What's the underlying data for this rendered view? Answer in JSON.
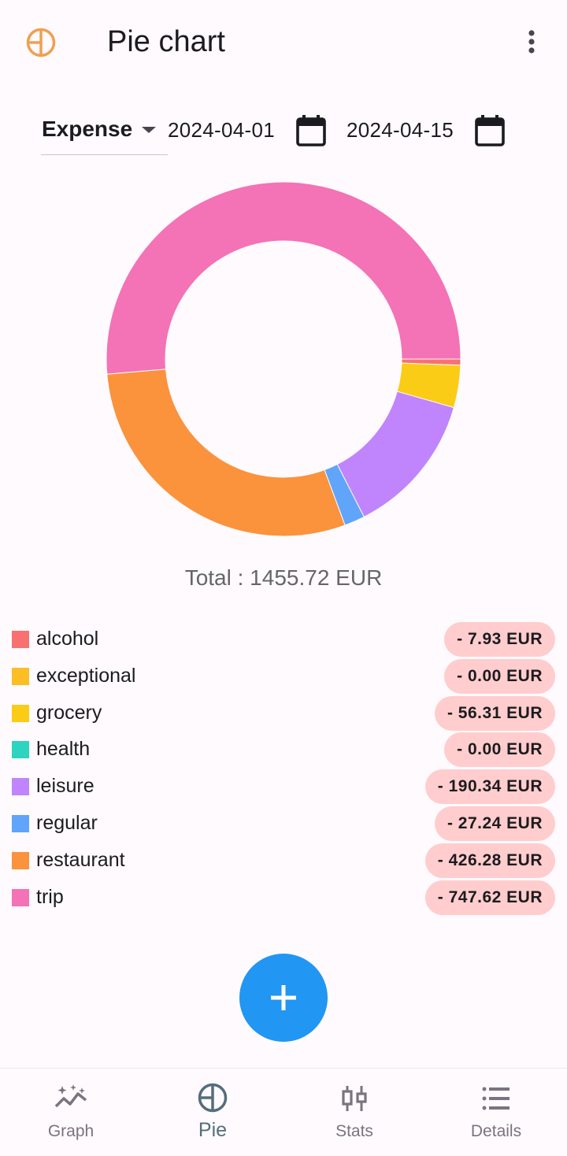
{
  "app_bar": {
    "title": "Pie chart",
    "logo_icon": "pie-chart-icon",
    "menu_icon": "more-vert-icon"
  },
  "filters": {
    "type": "Expense",
    "start_date": "2024-04-01",
    "end_date": "2024-04-15",
    "calendar_icon": "calendar-icon"
  },
  "chart_data": {
    "type": "pie",
    "donut": true,
    "categories": [
      "alcohol",
      "exceptional",
      "grocery",
      "health",
      "leisure",
      "regular",
      "restaurant",
      "trip"
    ],
    "values": [
      7.93,
      0.0,
      56.31,
      0.0,
      190.34,
      27.24,
      426.28,
      747.62
    ],
    "colors": [
      "#f87171",
      "#fbbf24",
      "#facc15",
      "#2dd4bf",
      "#c084fc",
      "#60a5fa",
      "#fb923c",
      "#f472b6"
    ],
    "total": 1455.72,
    "currency": "EUR"
  },
  "total_line": "Total : 1455.72 EUR",
  "legend": [
    {
      "label": "alcohol",
      "amount": "- 7.93 EUR",
      "color": "#f87171"
    },
    {
      "label": "exceptional",
      "amount": "- 0.00 EUR",
      "color": "#fbbf24"
    },
    {
      "label": "grocery",
      "amount": "- 56.31 EUR",
      "color": "#facc15"
    },
    {
      "label": "health",
      "amount": "- 0.00 EUR",
      "color": "#2dd4bf"
    },
    {
      "label": "leisure",
      "amount": "- 190.34 EUR",
      "color": "#c084fc"
    },
    {
      "label": "regular",
      "amount": "- 27.24 EUR",
      "color": "#60a5fa"
    },
    {
      "label": "restaurant",
      "amount": "- 426.28 EUR",
      "color": "#fb923c"
    },
    {
      "label": "trip",
      "amount": "- 747.62 EUR",
      "color": "#f472b6"
    }
  ],
  "fab": {
    "icon": "plus-icon",
    "color": "#2196f3"
  },
  "bottom_nav": {
    "graph": "Graph",
    "pie": "Pie",
    "stats": "Stats",
    "details": "Details",
    "active": "pie"
  },
  "colors": {
    "accent": "#f0a050",
    "amount_pill": "#ffcdcd",
    "nav_active": "#546e7a",
    "nav_inactive": "#79747e"
  }
}
